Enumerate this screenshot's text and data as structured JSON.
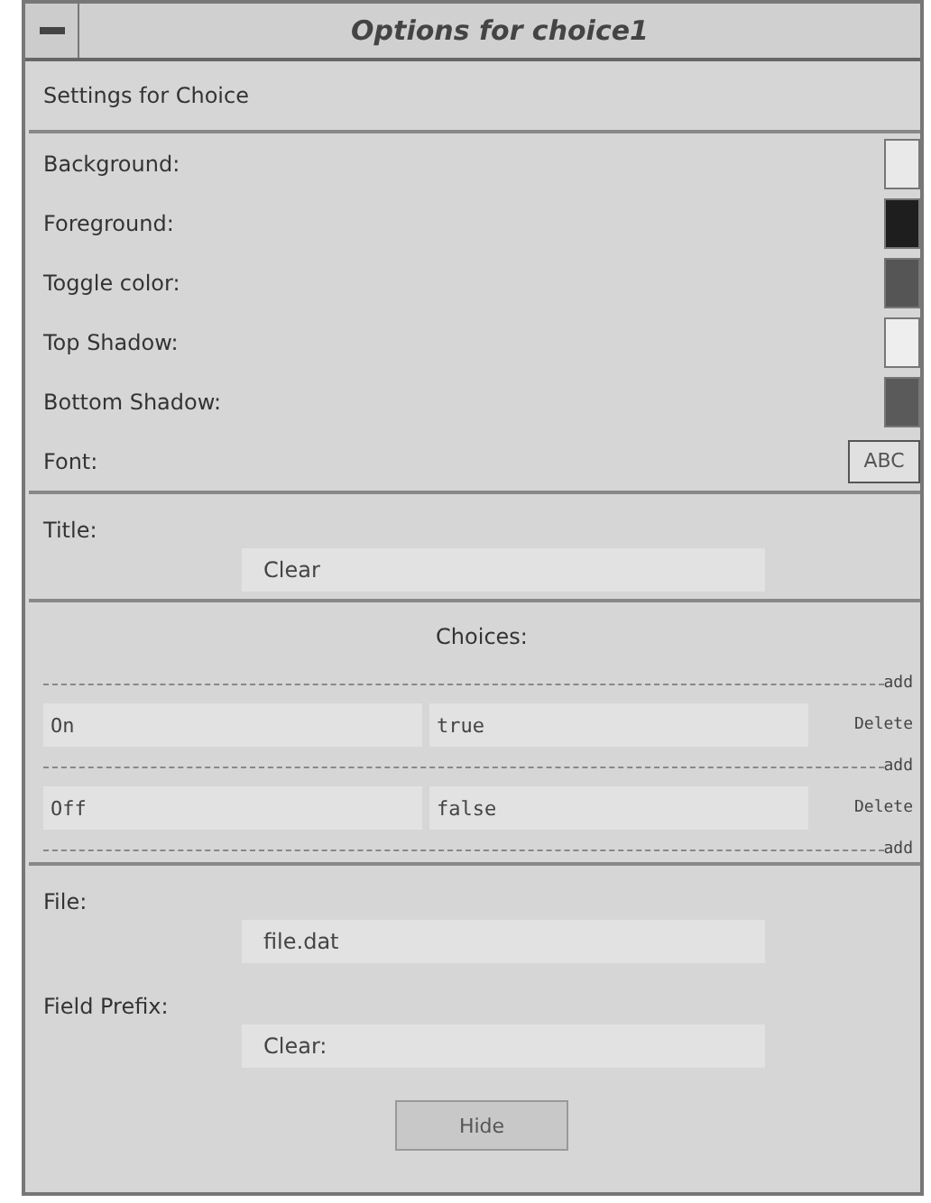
{
  "window": {
    "title": "Options for choice1"
  },
  "heading": "Settings for Choice",
  "colors": [
    {
      "label": "Background:",
      "kind": "color",
      "color": "#e9e9e9"
    },
    {
      "label": "Foreground:",
      "kind": "color",
      "color": "#1e1e1e"
    },
    {
      "label": "Toggle color:",
      "kind": "color",
      "color": "#555555"
    },
    {
      "label": "Top Shadow:",
      "kind": "color",
      "color": "#eeeeee"
    },
    {
      "label": "Bottom Shadow:",
      "kind": "color",
      "color": "#5a5a5a"
    },
    {
      "label": "Font:",
      "kind": "font",
      "sample": "ABC"
    }
  ],
  "title_field": {
    "label": "Title:",
    "value": "Clear"
  },
  "choices": {
    "heading": "Choices:",
    "add_links": [
      "add",
      "add",
      "add"
    ],
    "rows": [
      {
        "name": "On",
        "value": "true",
        "delete_label": "Delete"
      },
      {
        "name": "Off",
        "value": "false",
        "delete_label": "Delete"
      }
    ]
  },
  "file_field": {
    "label": "File:",
    "value": "file.dat"
  },
  "prefix_field": {
    "label": "Field Prefix:",
    "value": "Clear:"
  },
  "buttons": [
    "Hide"
  ]
}
